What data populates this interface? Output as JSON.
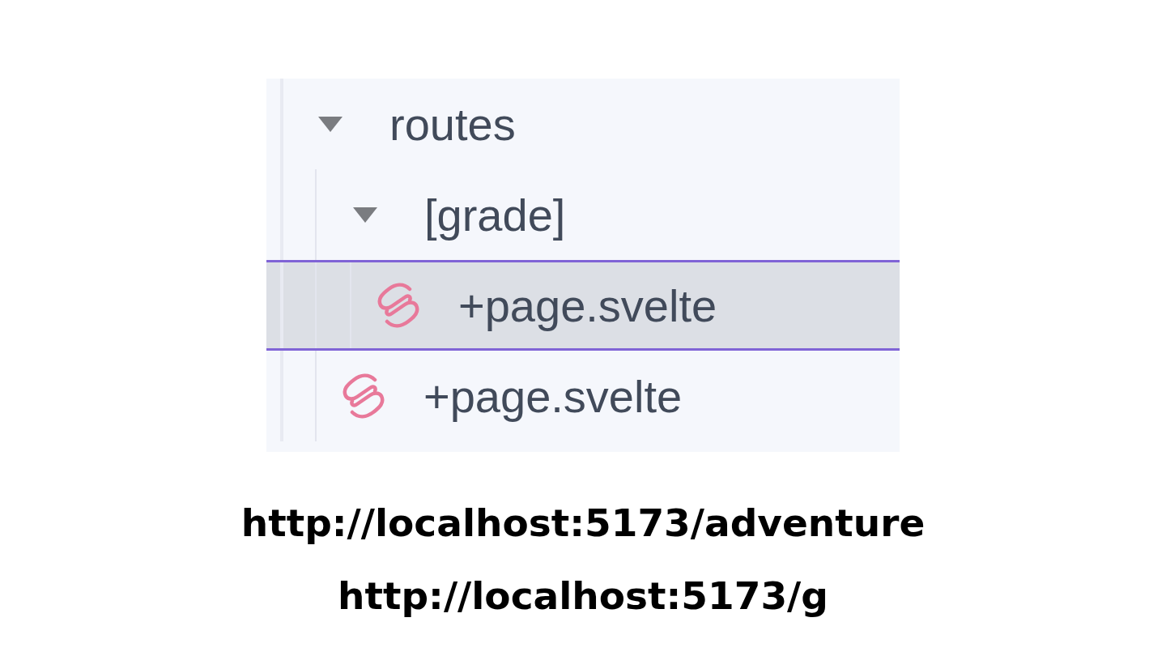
{
  "file_tree": [
    {
      "name": "routes",
      "kind": "folder",
      "expanded": true,
      "selected": false,
      "children": [
        {
          "name": "[grade]",
          "kind": "folder",
          "expanded": true,
          "selected": false,
          "children": [
            {
              "name": "+page.svelte",
              "kind": "svelte",
              "selected": true
            }
          ]
        },
        {
          "name": "+page.svelte",
          "kind": "svelte",
          "selected": false
        }
      ]
    }
  ],
  "urls": [
    "http://localhost:5173/adventure",
    "http://localhost:5173/g"
  ]
}
